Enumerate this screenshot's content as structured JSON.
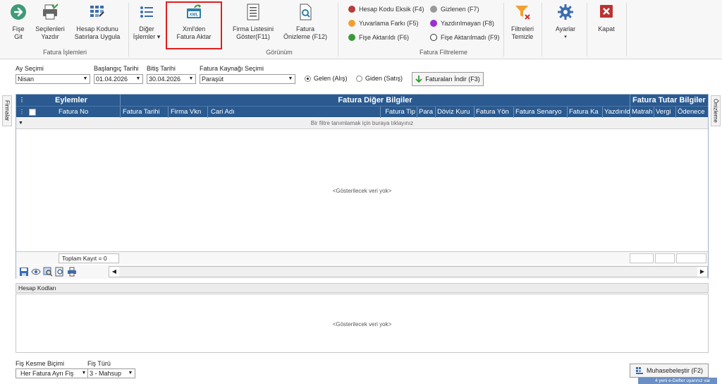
{
  "ribbon": {
    "groups": {
      "fatura_islemleri": "Fatura İşlemleri",
      "gorunum": "Görünüm",
      "fatura_filtreleme": "Fatura Filtreleme"
    },
    "buttons": {
      "fise_git": "Fişe\nGit",
      "secilenleri_yazdir": "Seçilenleri\nYazdır",
      "hesap_kodunu": "Hesap Kodunu\nSatırlara Uygula",
      "diger_islemler": "Diğer\nİşlemler ▾",
      "xml_den": "Xml'den\nFatura Aktar",
      "firma_listesini": "Firma Listesini\nGöster(F11)",
      "fatura_onizleme": "Fatura\nÖnizleme (F12)",
      "filtreleri_temizle": "Filtreleri\nTemizle",
      "ayarlar": "Ayarlar",
      "ayarlar_arrow": "▾",
      "kapat": "Kapat"
    },
    "filters": [
      {
        "label": "Hesap Kodu Eksik (F4)",
        "color": "#b83b3b"
      },
      {
        "label": "Yuvarlama Farkı (F5)",
        "color": "#f0a030"
      },
      {
        "label": "Fişe Aktarıldı (F6)",
        "color": "#3a9a3a"
      },
      {
        "label": "Gizlenen (F7)",
        "color": "#9a9a9a"
      },
      {
        "label": "Yazdırılmayan (F8)",
        "color": "#9a2fd0"
      },
      {
        "label": "Fişe Aktarılmadı (F9)",
        "color": "ring"
      }
    ]
  },
  "params": {
    "ay_secimi": {
      "label": "Ay Seçimi",
      "value": "Nisan"
    },
    "baslangic": {
      "label": "Başlangıç Tarihi",
      "value": "01.04.2026"
    },
    "bitis": {
      "label": "Bitiş Tarihi",
      "value": "30.04.2026"
    },
    "kaynak": {
      "label": "Fatura Kaynağı Seçimi",
      "value": "Paraşüt"
    },
    "radio_gelen": "Gelen (Alış)",
    "radio_giden": "Giden (Satış)",
    "download_btn": "Faturaları İndir (F3)"
  },
  "side_tabs": {
    "left": "Firmalar",
    "right": "Önizleme"
  },
  "grid": {
    "bands": {
      "eylemler": "Eylemler",
      "diger": "Fatura Diğer Bilgiler",
      "tutar": "Fatura Tutar Bilgiler"
    },
    "columns": [
      "Fatura No",
      "Fatura Tarihi",
      "Firma Vkn",
      "Cari Adı",
      "Fatura Tip",
      "Para",
      "Döviz Kuru",
      "Fatura Yön",
      "Fatura Senaryo",
      "Fatura Ka",
      "Yazdırıld",
      "Matrah",
      "Vergi",
      "Ödenece"
    ],
    "filter_hint": "Bir filtre tanımlamak için buraya tıklayınız",
    "empty_text": "<Gösterilecek veri yok>",
    "total_count": "Toplam Kayıt = 0"
  },
  "hesap_kodlari": {
    "title": "Hesap Kodları",
    "empty_text": "<Gösterilecek veri yok>"
  },
  "bottom": {
    "fis_kesme_label": "Fiş Kesme Biçimi",
    "fis_kesme_value": "Her Fatura Ayrı Fiş",
    "fis_turu_label": "Fiş Türü",
    "fis_turu_value": "3 - Mahsup",
    "muhasebelestir": "Muhasebeleştir (F2)",
    "toast": "4 yeni e-Defter uyarınız var"
  }
}
